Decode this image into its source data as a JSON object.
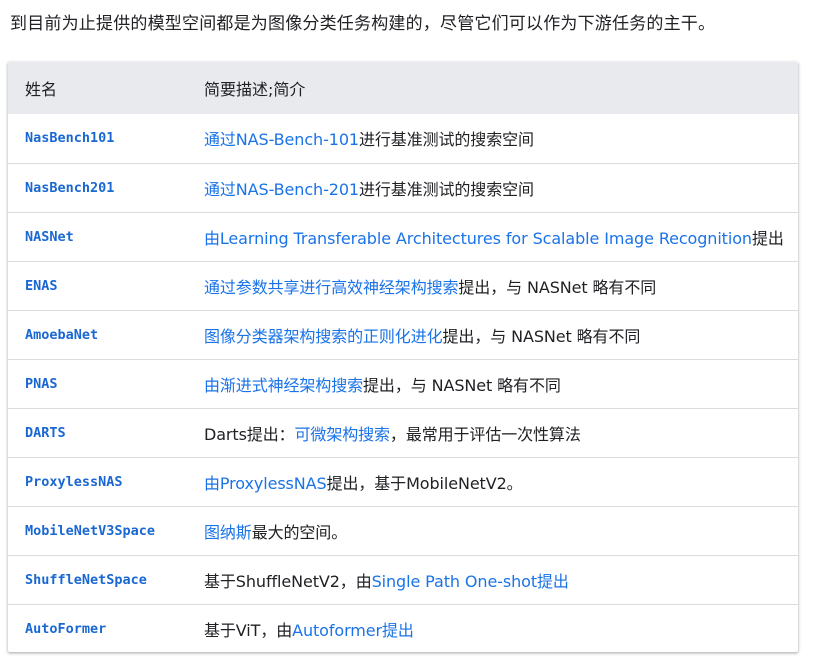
{
  "intro_text": "到目前为止提供的模型空间都是为图像分类任务构建的，尽管它们可以作为下游任务的主干。",
  "table": {
    "headers": [
      "姓名",
      "简要描述;简介"
    ],
    "rows": [
      {
        "name": "NasBench101",
        "desc": [
          {
            "text": "通过NAS-Bench-101",
            "link": true
          },
          {
            "text": "进行基准测试的搜索空间",
            "link": false
          }
        ]
      },
      {
        "name": "NasBench201",
        "desc": [
          {
            "text": "通过NAS-Bench-201",
            "link": true
          },
          {
            "text": "进行基准测试的搜索空间",
            "link": false
          }
        ]
      },
      {
        "name": "NASNet",
        "desc": [
          {
            "text": "由Learning Transferable Architectures for Scalable Image Recognition",
            "link": true
          },
          {
            "text": "提出",
            "link": false
          }
        ]
      },
      {
        "name": "ENAS",
        "desc": [
          {
            "text": "通过参数共享进行高效神经架构搜索",
            "link": true
          },
          {
            "text": "提出，与 NASNet 略有不同",
            "link": false
          }
        ]
      },
      {
        "name": "AmoebaNet",
        "desc": [
          {
            "text": "图像分类器架构搜索的正则化进化",
            "link": true
          },
          {
            "text": "提出，与 NASNet 略有不同",
            "link": false
          }
        ]
      },
      {
        "name": "PNAS",
        "desc": [
          {
            "text": "由渐进式神经架构搜索",
            "link": true
          },
          {
            "text": "提出，与 NASNet 略有不同",
            "link": false
          }
        ]
      },
      {
        "name": "DARTS",
        "desc": [
          {
            "text": "Darts提出：",
            "link": false
          },
          {
            "text": "可微架构搜索",
            "link": true
          },
          {
            "text": "，最常用于评估一次性算法",
            "link": false
          }
        ]
      },
      {
        "name": "ProxylessNAS",
        "desc": [
          {
            "text": "由ProxylessNAS",
            "link": true
          },
          {
            "text": "提出，基于MobileNetV2。",
            "link": false
          }
        ]
      },
      {
        "name": "MobileNetV3Space",
        "desc": [
          {
            "text": "图纳斯",
            "link": true
          },
          {
            "text": "最大的空间。",
            "link": false
          }
        ]
      },
      {
        "name": "ShuffleNetSpace",
        "desc": [
          {
            "text": "基于ShuffleNetV2，由",
            "link": false
          },
          {
            "text": "Single Path One-shot提出",
            "link": true
          }
        ]
      },
      {
        "name": "AutoFormer",
        "desc": [
          {
            "text": "基于ViT，由",
            "link": false
          },
          {
            "text": "Autoformer提出",
            "link": true
          }
        ]
      }
    ]
  }
}
